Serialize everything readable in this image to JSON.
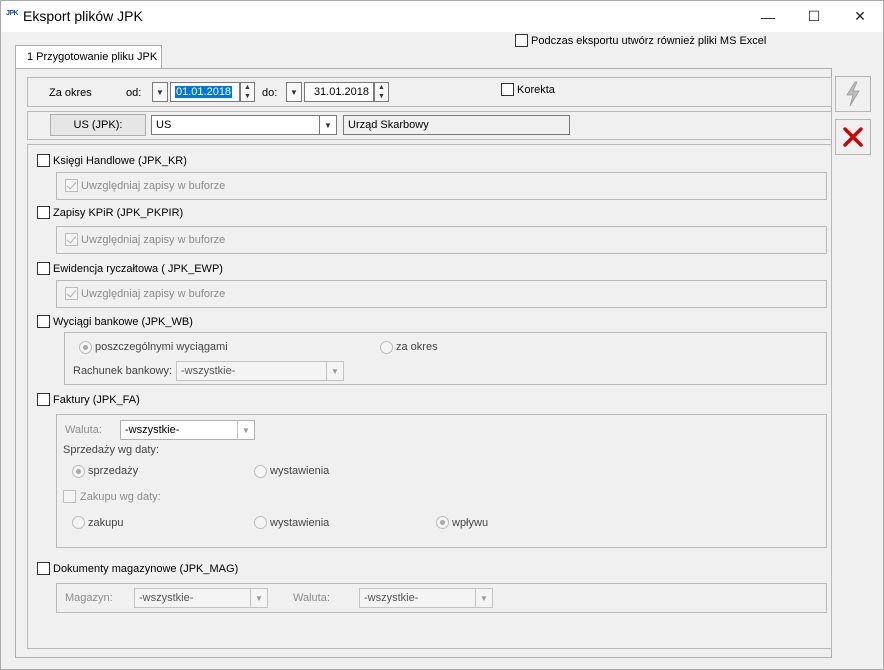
{
  "window": {
    "app_icon": "JPK",
    "title": "Eksport plików JPK",
    "minimize": "—",
    "maximize": "☐",
    "close": "✕"
  },
  "excel_option": {
    "label": "Podczas eksportu utwórz również pliki MS Excel",
    "checked": false
  },
  "tab": {
    "label": "1 Przygotowanie pliku JPK"
  },
  "period": {
    "label": "Za okres",
    "from_label": "od:",
    "from_value": "01.01.2018",
    "to_label": "do:",
    "to_value": "31.01.2018",
    "correction_label": "Korekta"
  },
  "office": {
    "button_label": "US (JPK):",
    "code": "US",
    "name": "Urząd Skarbowy"
  },
  "sections": {
    "kr": {
      "label": "Księgi Handlowe (JPK_KR)",
      "buffer_label": "Uwzględniaj zapisy w buforze"
    },
    "pkpir": {
      "label": "Zapisy KPiR (JPK_PKPIR)",
      "buffer_label": "Uwzględniaj zapisy w buforze"
    },
    "ewp": {
      "label": "Ewidencja ryczałtowa ( JPK_EWP)",
      "buffer_label": "Uwzględniaj zapisy w buforze"
    },
    "wb": {
      "label": "Wyciągi bankowe (JPK_WB)",
      "radio_individual": "poszczególnymi wyciągami",
      "radio_period": "za okres",
      "account_label": "Rachunek bankowy:",
      "account_value": "-wszystkie-"
    },
    "fa": {
      "label": "Faktury (JPK_FA)",
      "currency_label": "Waluta:",
      "currency_value": "-wszystkie-",
      "sales_by_date": "Sprzedaży wg daty:",
      "sales_radio_sale": "sprzedaży",
      "sales_radio_issue": "wystawienia",
      "purchase_by_date": "Zakupu wg daty:",
      "purchase_radio_purchase": "zakupu",
      "purchase_radio_issue": "wystawienia",
      "purchase_radio_receipt": "wpływu"
    },
    "mag": {
      "label": "Dokumenty magazynowe (JPK_MAG)",
      "warehouse_label": "Magazyn:",
      "warehouse_value": "-wszystkie-",
      "currency_label": "Waluta:",
      "currency_value": "-wszystkie-"
    }
  },
  "side_buttons": {
    "export_icon": "lightning-icon",
    "cancel_icon": "close-icon"
  },
  "colors": {
    "selection": "#0078d7",
    "cancel_red": "#d40000"
  }
}
